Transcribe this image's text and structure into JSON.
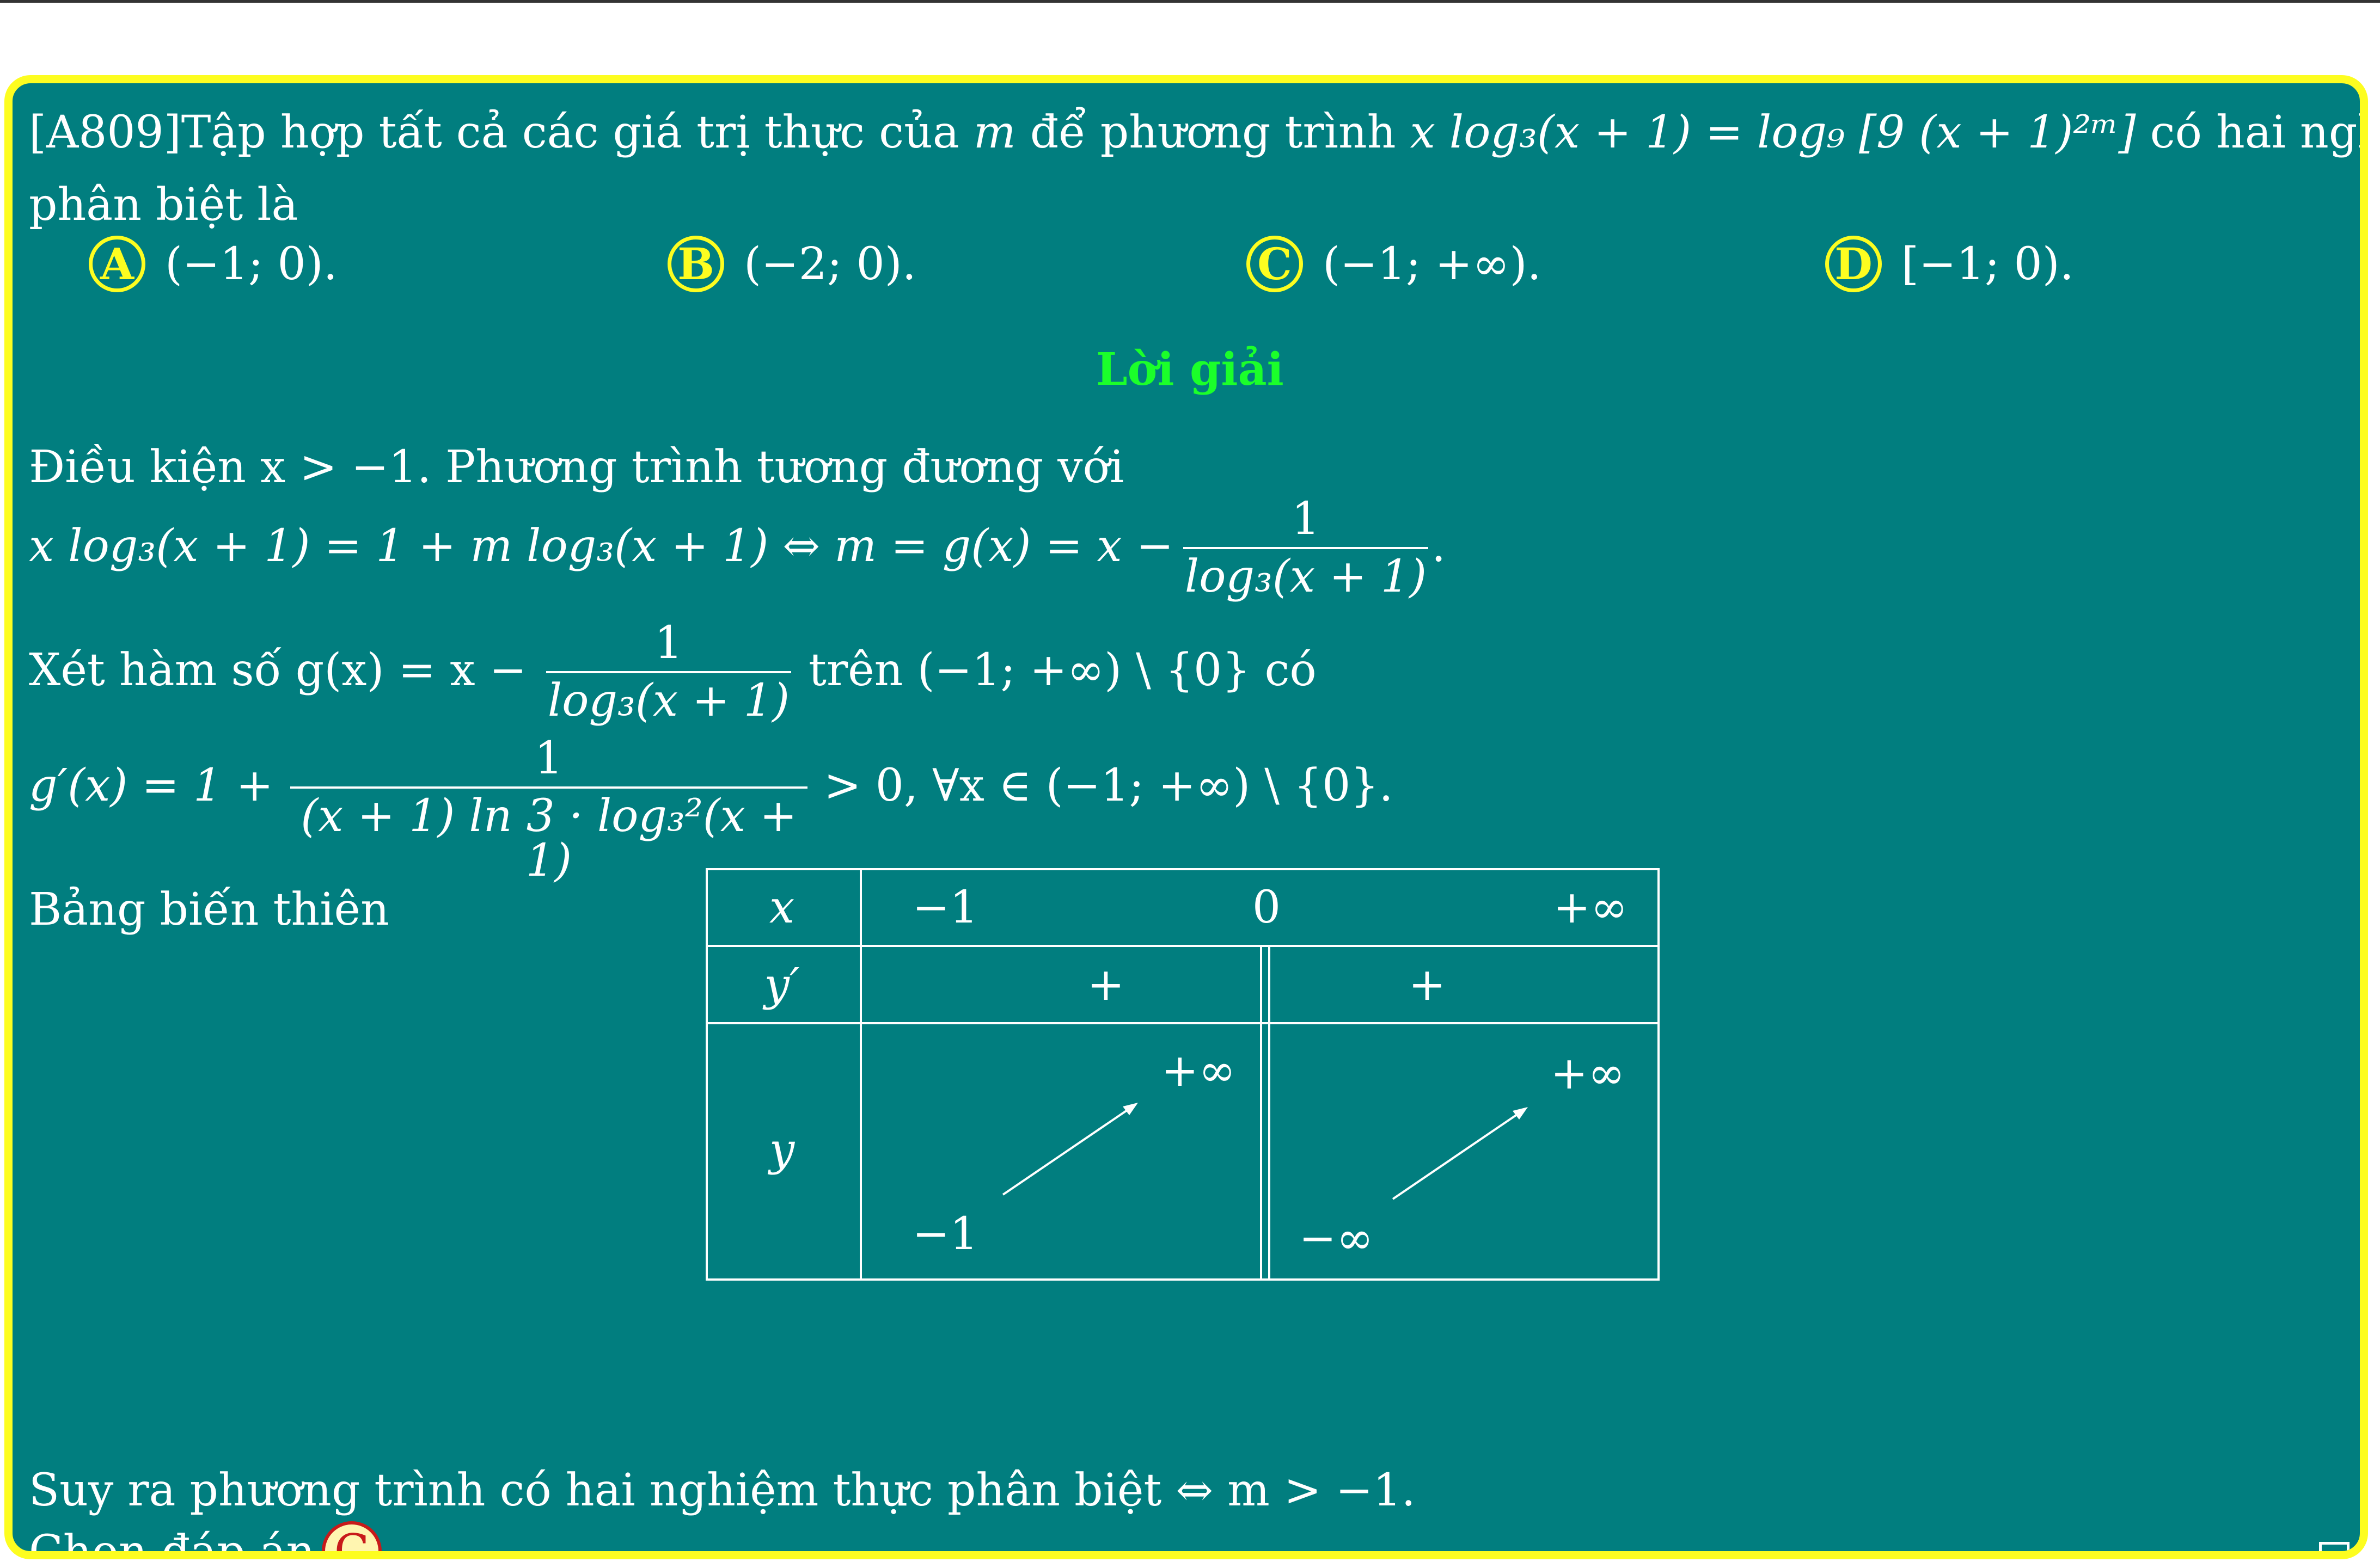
{
  "question": {
    "code": "[A809]",
    "stem_start": "Tập hợp tất cả các giá trị thực của ",
    "var_m": "m",
    "stem_mid": " để phương trình ",
    "equation": "x log₃(x + 1) = log₉ [9 (x + 1)²ᵐ]",
    "stem_end": " có hai nghiệm",
    "stem_line2": "phân biệt là"
  },
  "choices": [
    {
      "letter": "A",
      "text": "(−1; 0)."
    },
    {
      "letter": "B",
      "text": "(−2; 0)."
    },
    {
      "letter": "C",
      "text": "(−1; +∞)."
    },
    {
      "letter": "D",
      "text": "[−1; 0)."
    }
  ],
  "solution": {
    "heading": "Lời giải",
    "line1": "Điều kiện x > −1. Phương trình tương đương với",
    "line2_left": "x log₃(x + 1) = 1 + m log₃(x + 1) ⇔ m = g(x) = x −",
    "frac_num": "1",
    "frac_den": "log₃(x + 1)",
    "line2_end": ".",
    "line3_left": "Xét hàm số g(x) = x −",
    "line3_right": "trên (−1; +∞) \\ {0} có",
    "line4_left": "g′(x) = 1 +",
    "line4_den": "(x + 1) ln 3 · log₃²(x + 1)",
    "line4_right": "> 0, ∀x ∈ (−1; +∞) \\ {0}.",
    "line5": "Bảng biến thiên",
    "conclusion": "Suy ra phương trình có hai nghiệm thực phân biệt ⇔ m > −1.",
    "choose_label": "Chọn đáp án",
    "answer": "C"
  },
  "variation_table": {
    "row_labels": [
      "x",
      "y′",
      "y"
    ],
    "x_values": [
      "−1",
      "0",
      "+∞"
    ],
    "sign_values": [
      "+",
      "+"
    ],
    "y_values": {
      "left_bottom": "−1",
      "left_top": "+∞",
      "right_bottom": "−∞",
      "right_top": "+∞"
    }
  },
  "colors": {
    "background": "#017e7f",
    "border": "#fdfd20",
    "heading": "#1bff2a",
    "answer_badge_border": "#c81a1a"
  }
}
